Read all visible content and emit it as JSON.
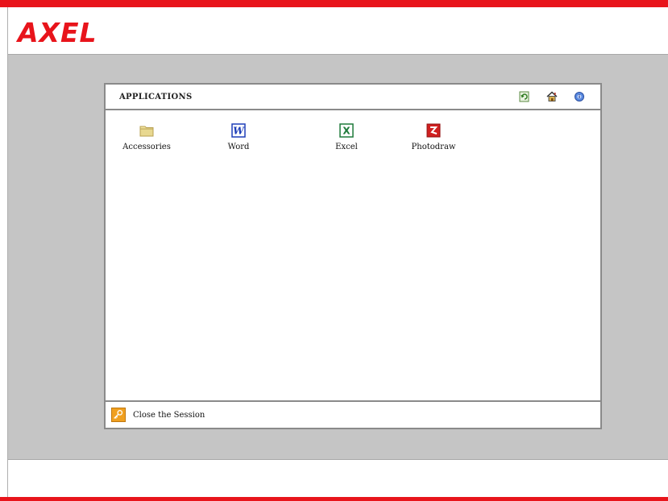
{
  "branding": {
    "logo_text": "AXEL",
    "accent_color": "#e8141b"
  },
  "panel": {
    "title": "APPLICATIONS",
    "header_icons": [
      "refresh-icon",
      "home-icon",
      "info-icon"
    ]
  },
  "apps": [
    {
      "label": "Accessories",
      "icon": "folder-icon",
      "color": "#e8d890"
    },
    {
      "label": "Word",
      "icon": "word-icon",
      "color": "#1f3fb8"
    },
    {
      "label": "Excel",
      "icon": "excel-icon",
      "color": "#1e7a3a"
    },
    {
      "label": "Photodraw",
      "icon": "photodraw-icon",
      "color": "#d02020"
    }
  ],
  "footer": {
    "close_label": "Close the Session",
    "icon": "key-icon"
  }
}
